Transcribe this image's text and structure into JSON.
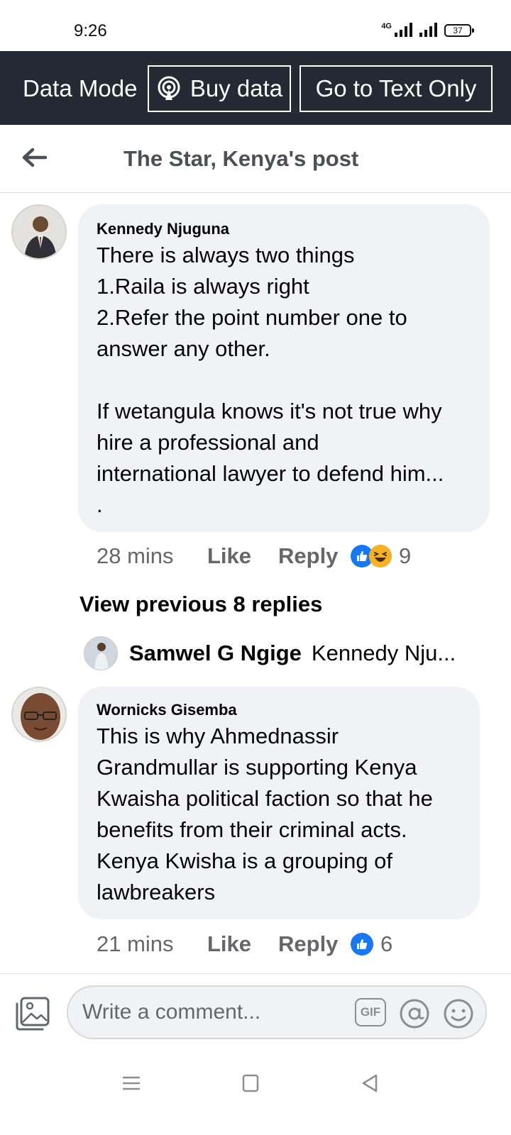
{
  "status_bar": {
    "time": "9:26",
    "network": "4G",
    "battery": "37"
  },
  "data_bar": {
    "mode_label": "Data Mode",
    "buy_label": "Buy data",
    "text_only_label": "Go to Text Only"
  },
  "header": {
    "title": "The Star, Kenya's post"
  },
  "comments": [
    {
      "author": "Kennedy Njuguna",
      "text": "There is always two things\n1.Raila is always right\n2.Refer the point number one to\nanswer any other.\n\nIf wetangula knows it's not true why\nhire a professional and\ninternational lawyer to defend him...\n.",
      "time": "28 mins",
      "like_label": "Like",
      "reply_label": "Reply",
      "reactions": [
        "like",
        "haha"
      ],
      "reaction_count": "9"
    },
    {
      "author": "Wornicks Gisemba",
      "text": "This is why Ahmednassir\nGrandmullar is supporting Kenya\nKwaisha political faction so that he\nbenefits from their criminal acts.\nKenya Kwisha is a grouping of\nlawbreakers",
      "time": "21 mins",
      "like_label": "Like",
      "reply_label": "Reply",
      "reactions": [
        "like"
      ],
      "reaction_count": "6"
    }
  ],
  "replies": {
    "view_previous": "View previous 8 replies",
    "latest_author": "Samwel G Ngige",
    "latest_snippet": "Kennedy Nju..."
  },
  "composer": {
    "placeholder": "Write a comment...",
    "gif_label": "GIF"
  },
  "colors": {
    "data_bar_bg": "#242a33",
    "bubble_bg": "#f0f2f5",
    "like_blue": "#1877f2",
    "haha_yellow": "#f7b125",
    "meta_gray": "#65676b"
  }
}
